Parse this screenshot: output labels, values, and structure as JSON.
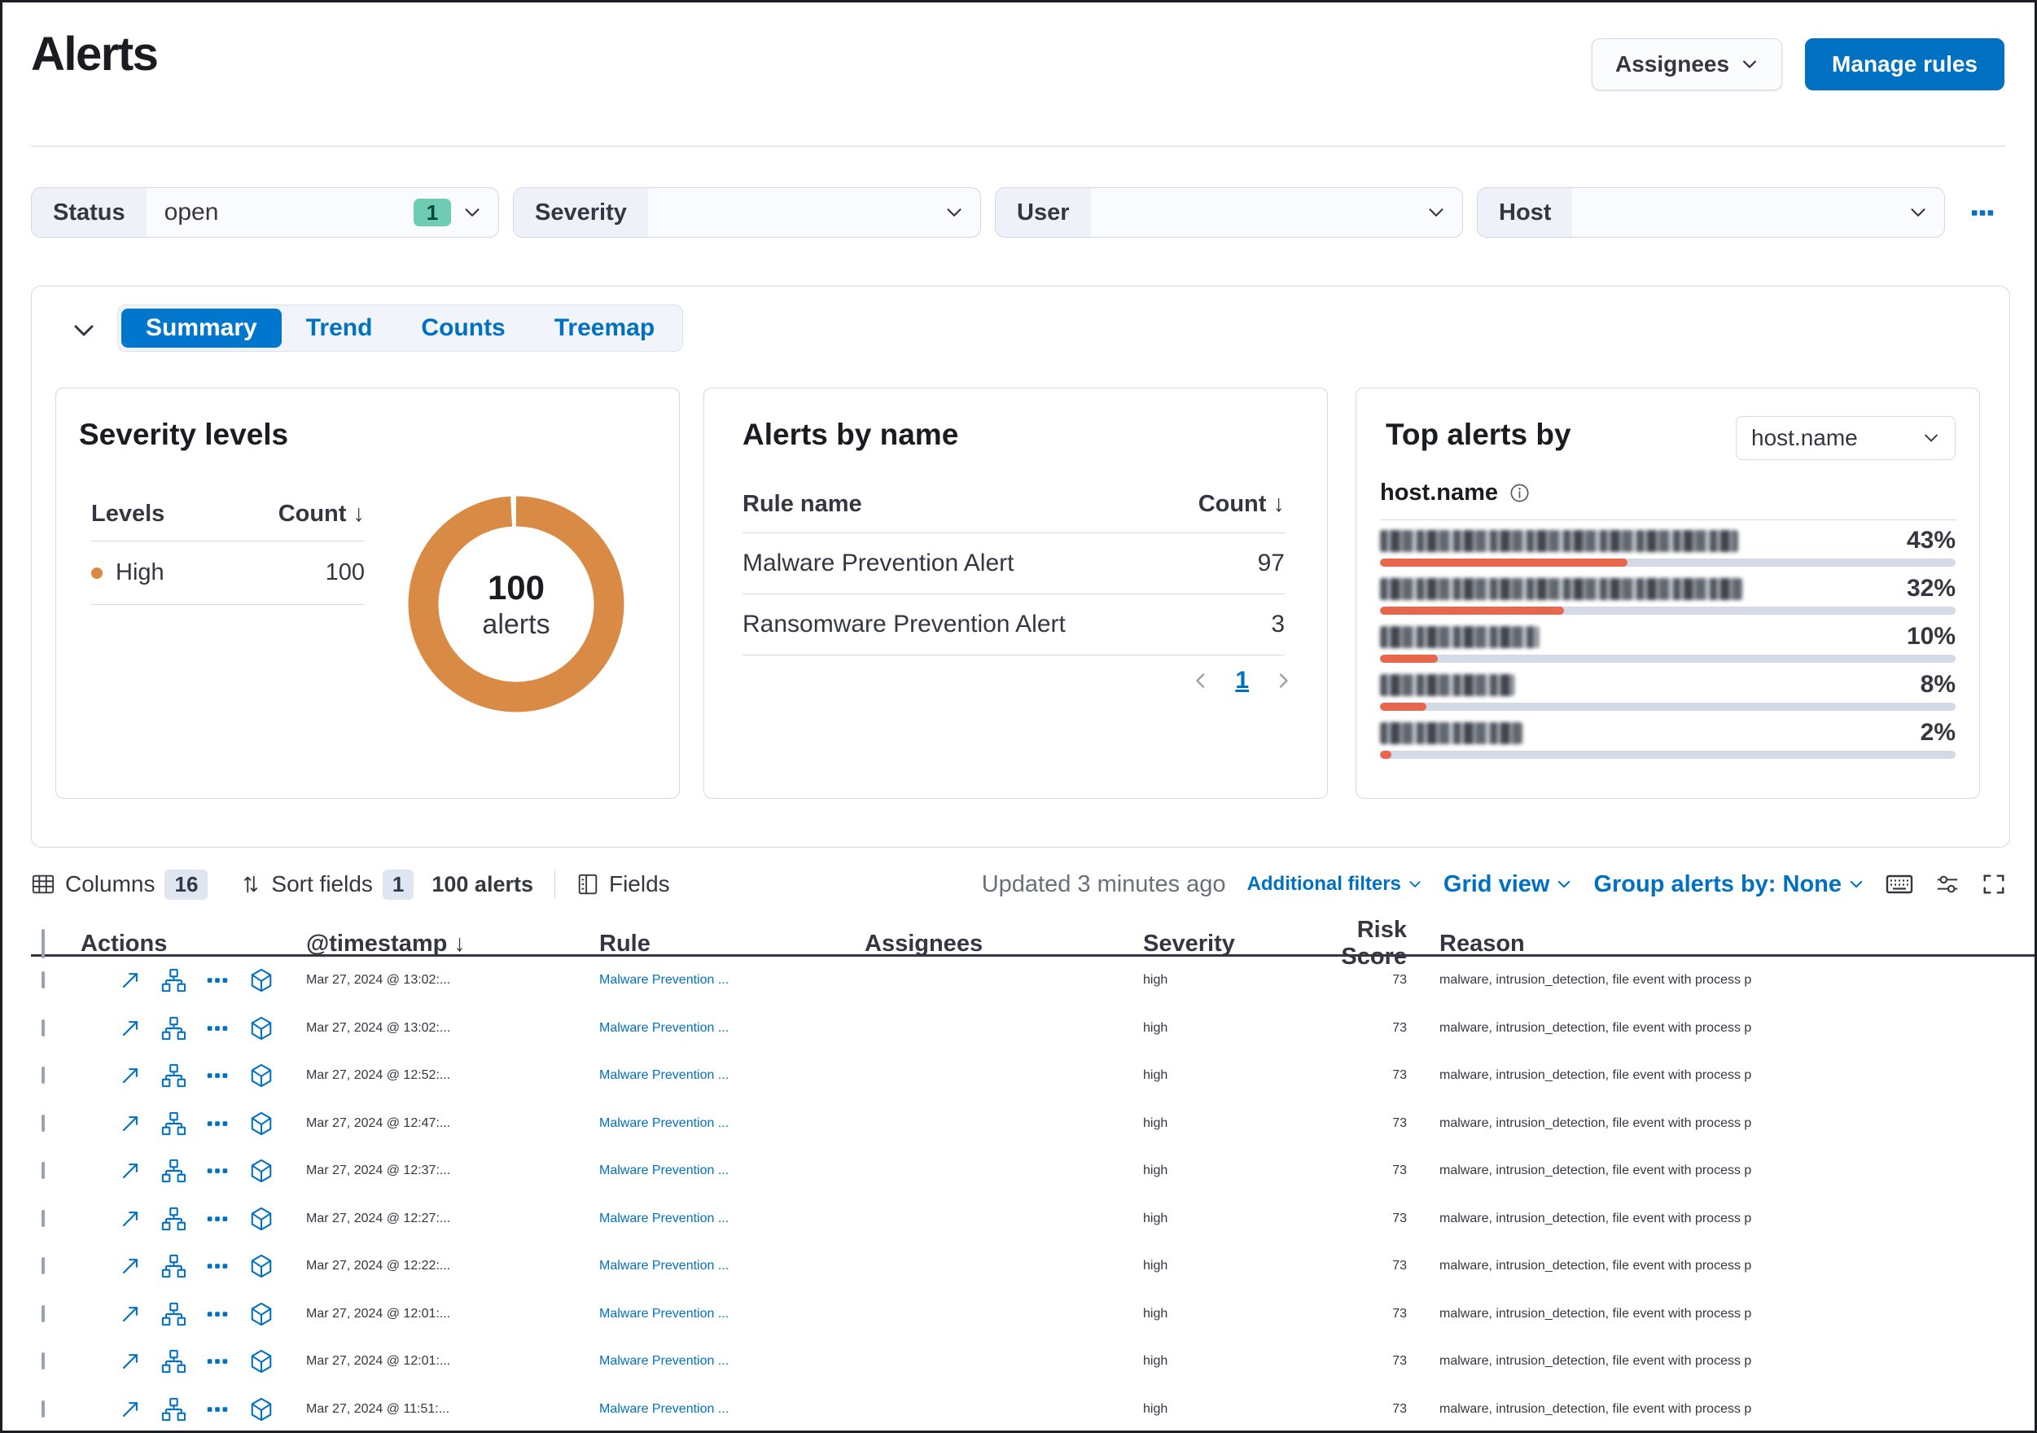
{
  "page": {
    "title": "Alerts"
  },
  "header": {
    "assignees_button": "Assignees",
    "manage_rules_button": "Manage rules"
  },
  "glyphs": {
    "sort_down": "↓"
  },
  "filters": {
    "status": {
      "label": "Status",
      "value": "open",
      "count": "1"
    },
    "severity": {
      "label": "Severity",
      "value": ""
    },
    "user": {
      "label": "User",
      "value": ""
    },
    "host": {
      "label": "Host",
      "value": ""
    }
  },
  "chart_tabs": {
    "summary": "Summary",
    "trend": "Trend",
    "counts": "Counts",
    "treemap": "Treemap"
  },
  "severity_panel": {
    "title": "Severity levels",
    "col_levels": "Levels",
    "col_count": "Count",
    "row_label": "High",
    "row_count": "100",
    "donut_value": "100",
    "donut_unit": "alerts",
    "high_color": "#d98b45"
  },
  "alerts_by_name_panel": {
    "title": "Alerts by name",
    "col_rule": "Rule name",
    "col_count": "Count",
    "rows": [
      {
        "name": "Malware Prevention Alert",
        "count": "97"
      },
      {
        "name": "Ransomware Prevention Alert",
        "count": "3"
      }
    ],
    "page": "1"
  },
  "top_alerts_panel": {
    "title": "Top alerts by",
    "select_value": "host.name",
    "field_label": "host.name",
    "bar_color": "#e7664c",
    "rows": [
      {
        "pct": "43%",
        "value": 43,
        "redacted_width": 440
      },
      {
        "pct": "32%",
        "value": 32,
        "redacted_width": 445
      },
      {
        "pct": "10%",
        "value": 10,
        "redacted_width": 195
      },
      {
        "pct": "8%",
        "value": 8,
        "redacted_width": 165
      },
      {
        "pct": "2%",
        "value": 2,
        "redacted_width": 175
      }
    ]
  },
  "toolbar": {
    "columns_label": "Columns",
    "columns_count": "16",
    "sort_label": "Sort fields",
    "sort_count": "1",
    "alert_count": "100 alerts",
    "fields_label": "Fields",
    "updated": "Updated 3 minutes ago",
    "additional_filters": "Additional filters",
    "grid_view": "Grid view",
    "group_by": "Group alerts by: None"
  },
  "table": {
    "headers": {
      "actions": "Actions",
      "timestamp": "@timestamp",
      "rule": "Rule",
      "assignees": "Assignees",
      "severity": "Severity",
      "risk_score": "Risk Score",
      "reason": "Reason"
    },
    "rows": [
      {
        "timestamp": "Mar 27, 2024 @ 13:02:...",
        "rule": "Malware Prevention ...",
        "assignees": "",
        "severity": "high",
        "risk": "73",
        "reason": "malware, intrusion_detection, file event with process p"
      },
      {
        "timestamp": "Mar 27, 2024 @ 13:02:...",
        "rule": "Malware Prevention ...",
        "assignees": "",
        "severity": "high",
        "risk": "73",
        "reason": "malware, intrusion_detection, file event with process p"
      },
      {
        "timestamp": "Mar 27, 2024 @ 12:52:...",
        "rule": "Malware Prevention ...",
        "assignees": "",
        "severity": "high",
        "risk": "73",
        "reason": "malware, intrusion_detection, file event with process p"
      },
      {
        "timestamp": "Mar 27, 2024 @ 12:47:...",
        "rule": "Malware Prevention ...",
        "assignees": "",
        "severity": "high",
        "risk": "73",
        "reason": "malware, intrusion_detection, file event with process p"
      },
      {
        "timestamp": "Mar 27, 2024 @ 12:37:...",
        "rule": "Malware Prevention ...",
        "assignees": "",
        "severity": "high",
        "risk": "73",
        "reason": "malware, intrusion_detection, file event with process p"
      },
      {
        "timestamp": "Mar 27, 2024 @ 12:27:...",
        "rule": "Malware Prevention ...",
        "assignees": "",
        "severity": "high",
        "risk": "73",
        "reason": "malware, intrusion_detection, file event with process p"
      },
      {
        "timestamp": "Mar 27, 2024 @ 12:22:...",
        "rule": "Malware Prevention ...",
        "assignees": "",
        "severity": "high",
        "risk": "73",
        "reason": "malware, intrusion_detection, file event with process p"
      },
      {
        "timestamp": "Mar 27, 2024 @ 12:01:...",
        "rule": "Malware Prevention ...",
        "assignees": "",
        "severity": "high",
        "risk": "73",
        "reason": "malware, intrusion_detection, file event with process p"
      },
      {
        "timestamp": "Mar 27, 2024 @ 12:01:...",
        "rule": "Malware Prevention ...",
        "assignees": "",
        "severity": "high",
        "risk": "73",
        "reason": "malware, intrusion_detection, file event with process p"
      },
      {
        "timestamp": "Mar 27, 2024 @ 11:51:...",
        "rule": "Malware Prevention ...",
        "assignees": "",
        "severity": "high",
        "risk": "73",
        "reason": "malware, intrusion_detection, file event with process p"
      }
    ]
  },
  "chart_data": [
    {
      "type": "pie",
      "title": "Severity levels",
      "categories": [
        "High"
      ],
      "values": [
        100
      ],
      "center_label": "100 alerts",
      "colors": [
        "#d98b45"
      ]
    },
    {
      "type": "bar",
      "title": "Top alerts by host.name",
      "categories": [
        "[redacted]",
        "[redacted]",
        "[redacted]",
        "[redacted]",
        "[redacted]"
      ],
      "values": [
        43,
        32,
        10,
        8,
        2
      ],
      "unit": "%",
      "bar_color": "#e7664c"
    }
  ]
}
